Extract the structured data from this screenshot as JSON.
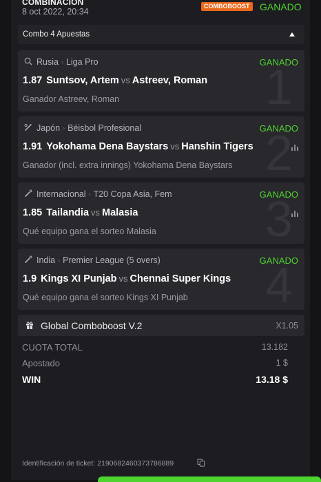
{
  "header": {
    "bet_type": "COMBINACIÓN",
    "date": "8 oct 2022, 20:34",
    "badge": "COMBOBOOST",
    "status": "GANADO"
  },
  "combo": {
    "title": "Combo 4 Apuestas"
  },
  "bets": [
    {
      "number": "1",
      "sport_icon": "table-tennis-icon",
      "country": "Rusia",
      "league": "Liga Pro",
      "status": "GANADO",
      "odds": "1.87",
      "team1": "Suntsov, Artem",
      "vs": "vs",
      "team2": "Astreev, Roman",
      "selection": "Ganador Astreev, Roman"
    },
    {
      "number": "2",
      "sport_icon": "baseball-icon",
      "country": "Japón",
      "league": "Béisbol Profesional",
      "status": "GANADO",
      "odds": "1.91",
      "team1": "Yokohama Dena Baystars",
      "vs": "vs",
      "team2": "Hanshin Tigers",
      "selection": "Ganador (incl. extra innings) Yokohama Dena Baystars"
    },
    {
      "number": "3",
      "sport_icon": "cricket-icon",
      "country": "Internacional",
      "league": "T20 Copa Asia, Fem",
      "status": "GANADO",
      "odds": "1.85",
      "team1": "Tailandia",
      "vs": "vs",
      "team2": "Malasia",
      "selection": "Qué equipo gana el sorteo Malasia"
    },
    {
      "number": "4",
      "sport_icon": "cricket-icon",
      "country": "India",
      "league": "Premier League (5 overs)",
      "status": "GANADO",
      "odds": "1.9",
      "team1": "Kings XI Punjab",
      "vs": "vs",
      "team2": "Chennai Super Kings",
      "selection": "Qué equipo gana el sorteo Kings XI Punjab"
    }
  ],
  "boost": {
    "name": "Global Comboboost V.2",
    "value": "X1.05"
  },
  "summary": {
    "total_odds_label": "CUOTA TOTAL",
    "total_odds": "13.182",
    "stake_label": "Apostado",
    "stake": "1 $",
    "win_label": "WIN",
    "win": "13.18 $"
  },
  "ticket": {
    "label": "Identificación de ticket:",
    "id": "2190682460373786889"
  },
  "colors": {
    "win_green": "#4ed42e",
    "badge_orange": "#e8671a",
    "card_bg": "#28282d"
  }
}
